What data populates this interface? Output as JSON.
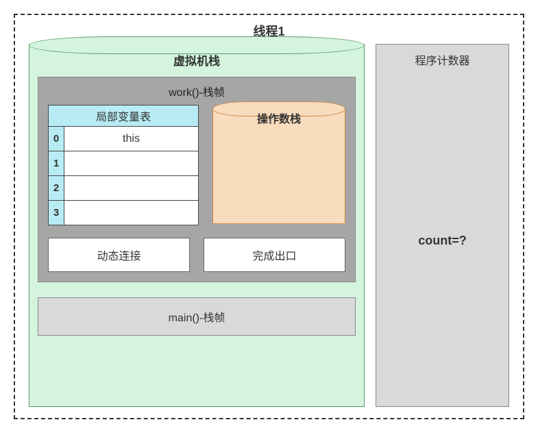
{
  "thread": {
    "title": "线程1"
  },
  "vm_stack": {
    "title": "虚拟机栈",
    "work_frame": {
      "title": "work()-栈帧",
      "lvt": {
        "title": "局部变量表",
        "rows": [
          {
            "idx": "0",
            "val": "this"
          },
          {
            "idx": "1",
            "val": ""
          },
          {
            "idx": "2",
            "val": ""
          },
          {
            "idx": "3",
            "val": ""
          }
        ]
      },
      "op_stack": {
        "title": "操作数栈"
      },
      "dyn_link": "动态连接",
      "return_exit": "完成出口"
    },
    "main_frame": {
      "title": "main()-栈帧"
    }
  },
  "pc": {
    "title": "程序计数器",
    "value": "count=?"
  }
}
